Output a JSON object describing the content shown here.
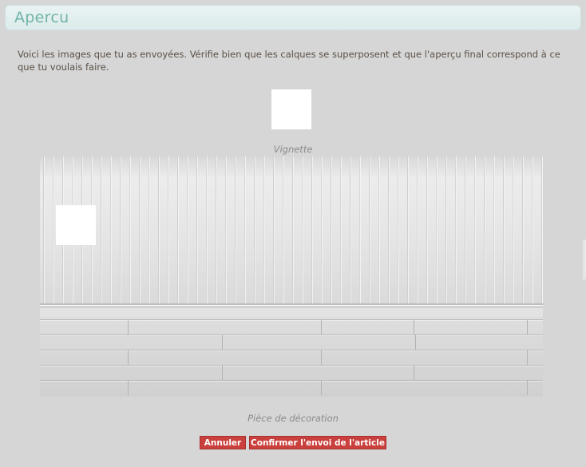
{
  "window": {
    "title": "Apercu"
  },
  "intro_text": "Voici les images que tu as envoyées. Vérifie bien que les calques se superposent et que l'aperçu final correspond à ce que tu voulais faire.",
  "thumbnail": {
    "caption": "Vignette"
  },
  "decoration": {
    "caption": "Pièce de décoration"
  },
  "actions": {
    "cancel_label": "Annuler",
    "confirm_label": "Confirmer l'envoi de l'article"
  },
  "colors": {
    "background": "#d6d6d6",
    "title_text": "#6fb3a8",
    "button": "#c9403c",
    "button_text": "#ffffff"
  }
}
